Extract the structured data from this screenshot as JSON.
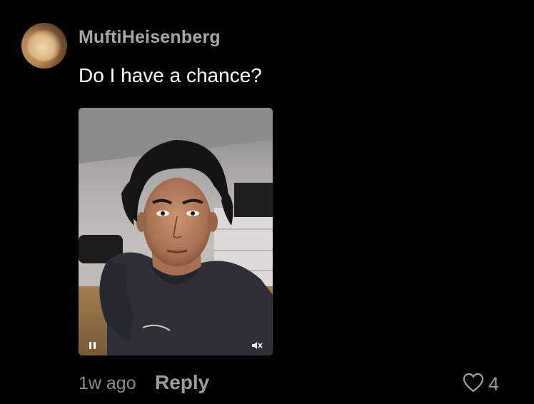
{
  "comment": {
    "username": "MuftiHeisenberg",
    "text": "Do I have a chance?",
    "timestamp": "1w ago",
    "reply_label": "Reply",
    "like_count": "4"
  },
  "video": {
    "state": "paused",
    "play_control_icon": "pause-icon",
    "volume_icon": "muted-speaker-icon"
  },
  "icons": {
    "like": "heart-outline-icon"
  },
  "colors": {
    "background": "#000000",
    "username": "#a7a7a7",
    "text": "#ffffff",
    "meta": "#8d8d8d"
  }
}
